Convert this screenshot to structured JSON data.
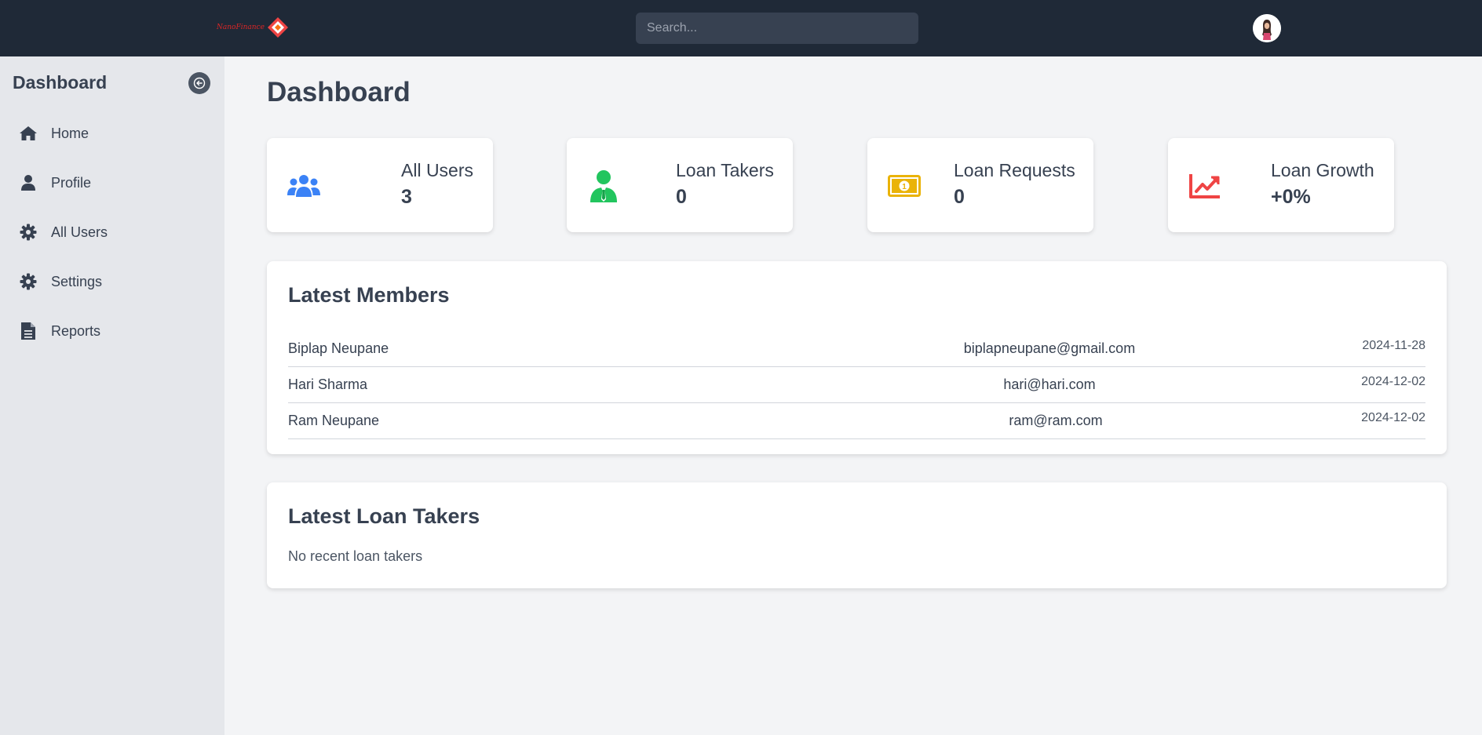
{
  "topbar": {
    "logo_text": "NanoFinance",
    "search_placeholder": "Search..."
  },
  "sidebar": {
    "title": "Dashboard",
    "items": [
      {
        "label": "Home",
        "icon": "home-icon"
      },
      {
        "label": "Profile",
        "icon": "user-icon"
      },
      {
        "label": "All Users",
        "icon": "gear-icon"
      },
      {
        "label": "Settings",
        "icon": "gear-icon"
      },
      {
        "label": "Reports",
        "icon": "file-icon"
      }
    ]
  },
  "main": {
    "title": "Dashboard",
    "stats": [
      {
        "label": "All Users",
        "value": "3",
        "icon": "users-icon",
        "color": "#3b82f6"
      },
      {
        "label": "Loan Takers",
        "value": "0",
        "icon": "user-tie-icon",
        "color": "#22c55e"
      },
      {
        "label": "Loan Requests",
        "value": "0",
        "icon": "money-bill-icon",
        "color": "#eab308"
      },
      {
        "label": "Loan Growth",
        "value": "+0%",
        "icon": "chart-line-icon",
        "color": "#ef4444"
      }
    ],
    "latest_members": {
      "title": "Latest Members",
      "rows": [
        {
          "name": "Biplap Neupane",
          "email": "biplapneupane@gmail.com",
          "date": "2024-11-28"
        },
        {
          "name": "Hari Sharma",
          "email": "hari@hari.com",
          "date": "2024-12-02"
        },
        {
          "name": "Ram Neupane",
          "email": "ram@ram.com",
          "date": "2024-12-02"
        }
      ]
    },
    "latest_loan_takers": {
      "title": "Latest Loan Takers",
      "empty_text": "No recent loan takers"
    }
  }
}
